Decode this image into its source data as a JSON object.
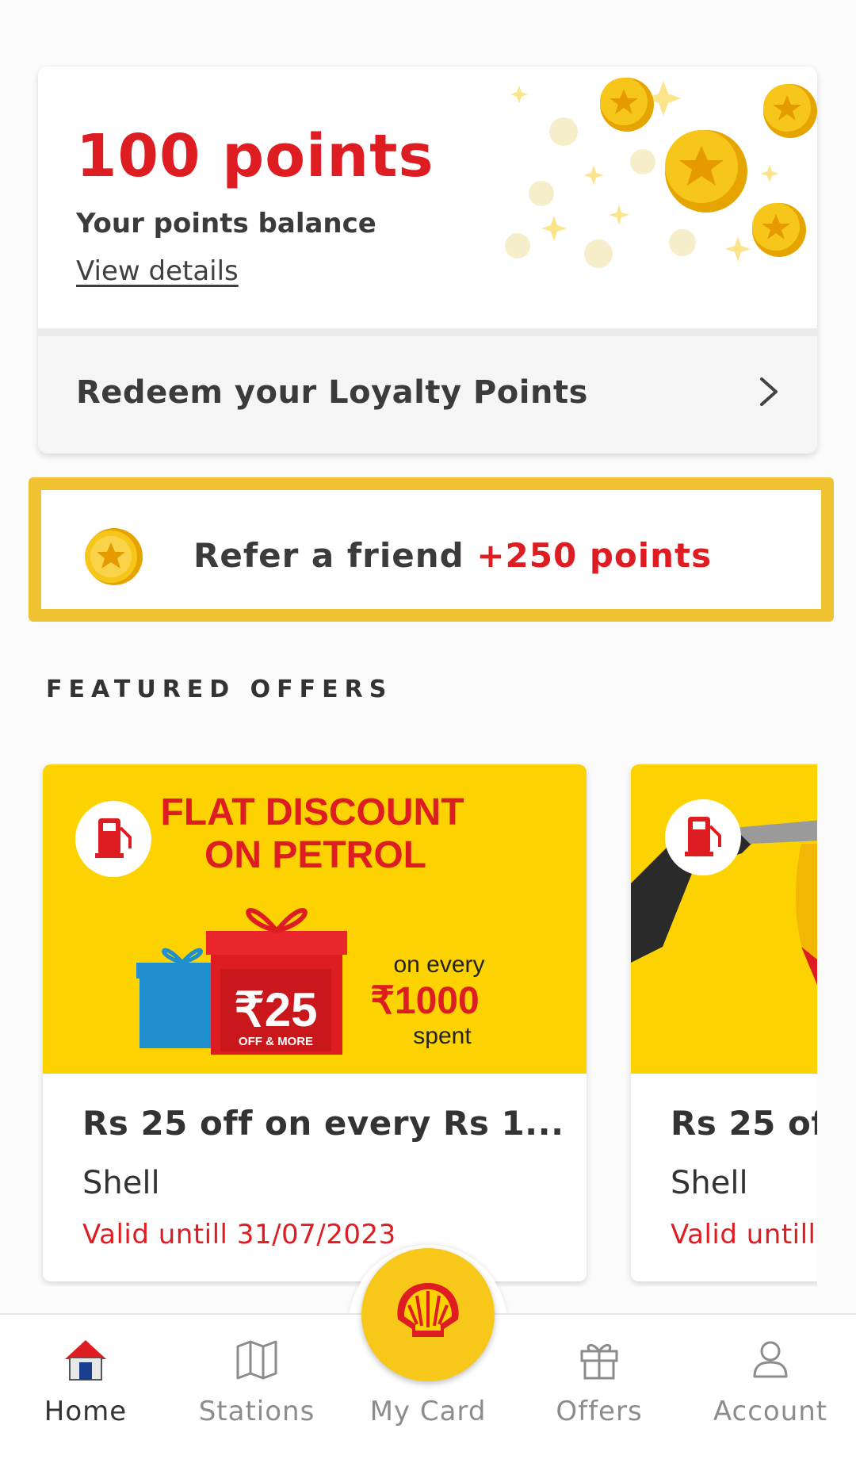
{
  "points_card": {
    "points_value": "100 points",
    "caption": "Your points balance",
    "details_link": "View details",
    "redeem_label": "Redeem your Loyalty Points"
  },
  "refer": {
    "label": "Refer a friend",
    "points": "+250 points"
  },
  "featured": {
    "title": "FEATURED OFFERS",
    "offers": [
      {
        "banner_headline_1": "FLAT DISCOUNT",
        "banner_headline_2": "ON PETROL",
        "banner_amount": "₹25",
        "banner_amount_sub": "OFF & MORE",
        "banner_on_every": "on every",
        "banner_threshold": "₹1000",
        "banner_spent": "spent",
        "title": "Rs 25 off on every Rs 1...",
        "brand": "Shell",
        "valid": "Valid untill 31/07/2023"
      },
      {
        "title": "Rs 25 of",
        "brand": "Shell",
        "valid": "Valid untill :"
      }
    ]
  },
  "nav": {
    "home": "Home",
    "stations": "Stations",
    "mycard": "My Card",
    "offers": "Offers",
    "account": "Account"
  },
  "colors": {
    "brand_red": "#dd1d21",
    "brand_yellow": "#fcd200",
    "refer_border": "#f1c232"
  },
  "icons": [
    "coins-illustration",
    "chevron-right-icon",
    "coin-icon",
    "fuel-pump-icon",
    "home-icon",
    "map-icon",
    "shell-logo-icon",
    "gift-icon",
    "user-icon"
  ]
}
